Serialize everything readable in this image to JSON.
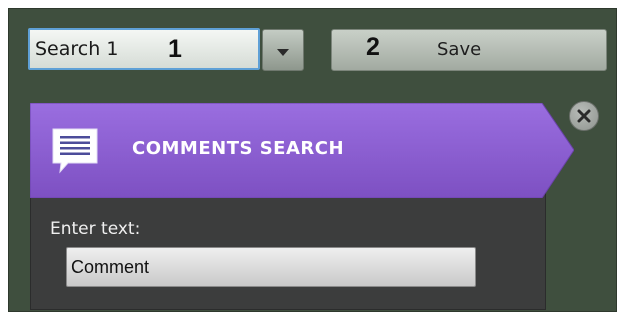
{
  "search_selector": {
    "value": "Search 1",
    "callout_number": "1"
  },
  "toolbar": {
    "save_label": "Save",
    "callout_number": "2"
  },
  "panel": {
    "title": "COMMENTS SEARCH",
    "header_color": "#8c5fcf",
    "icon": "comment-icon",
    "close_icon": "close-icon",
    "text_label": "Enter text:",
    "text_value": "Comment"
  },
  "colors": {
    "background": "#3f4f3e",
    "panel_body": "#3c3d3d",
    "accent_focus": "#5fa0d6"
  }
}
